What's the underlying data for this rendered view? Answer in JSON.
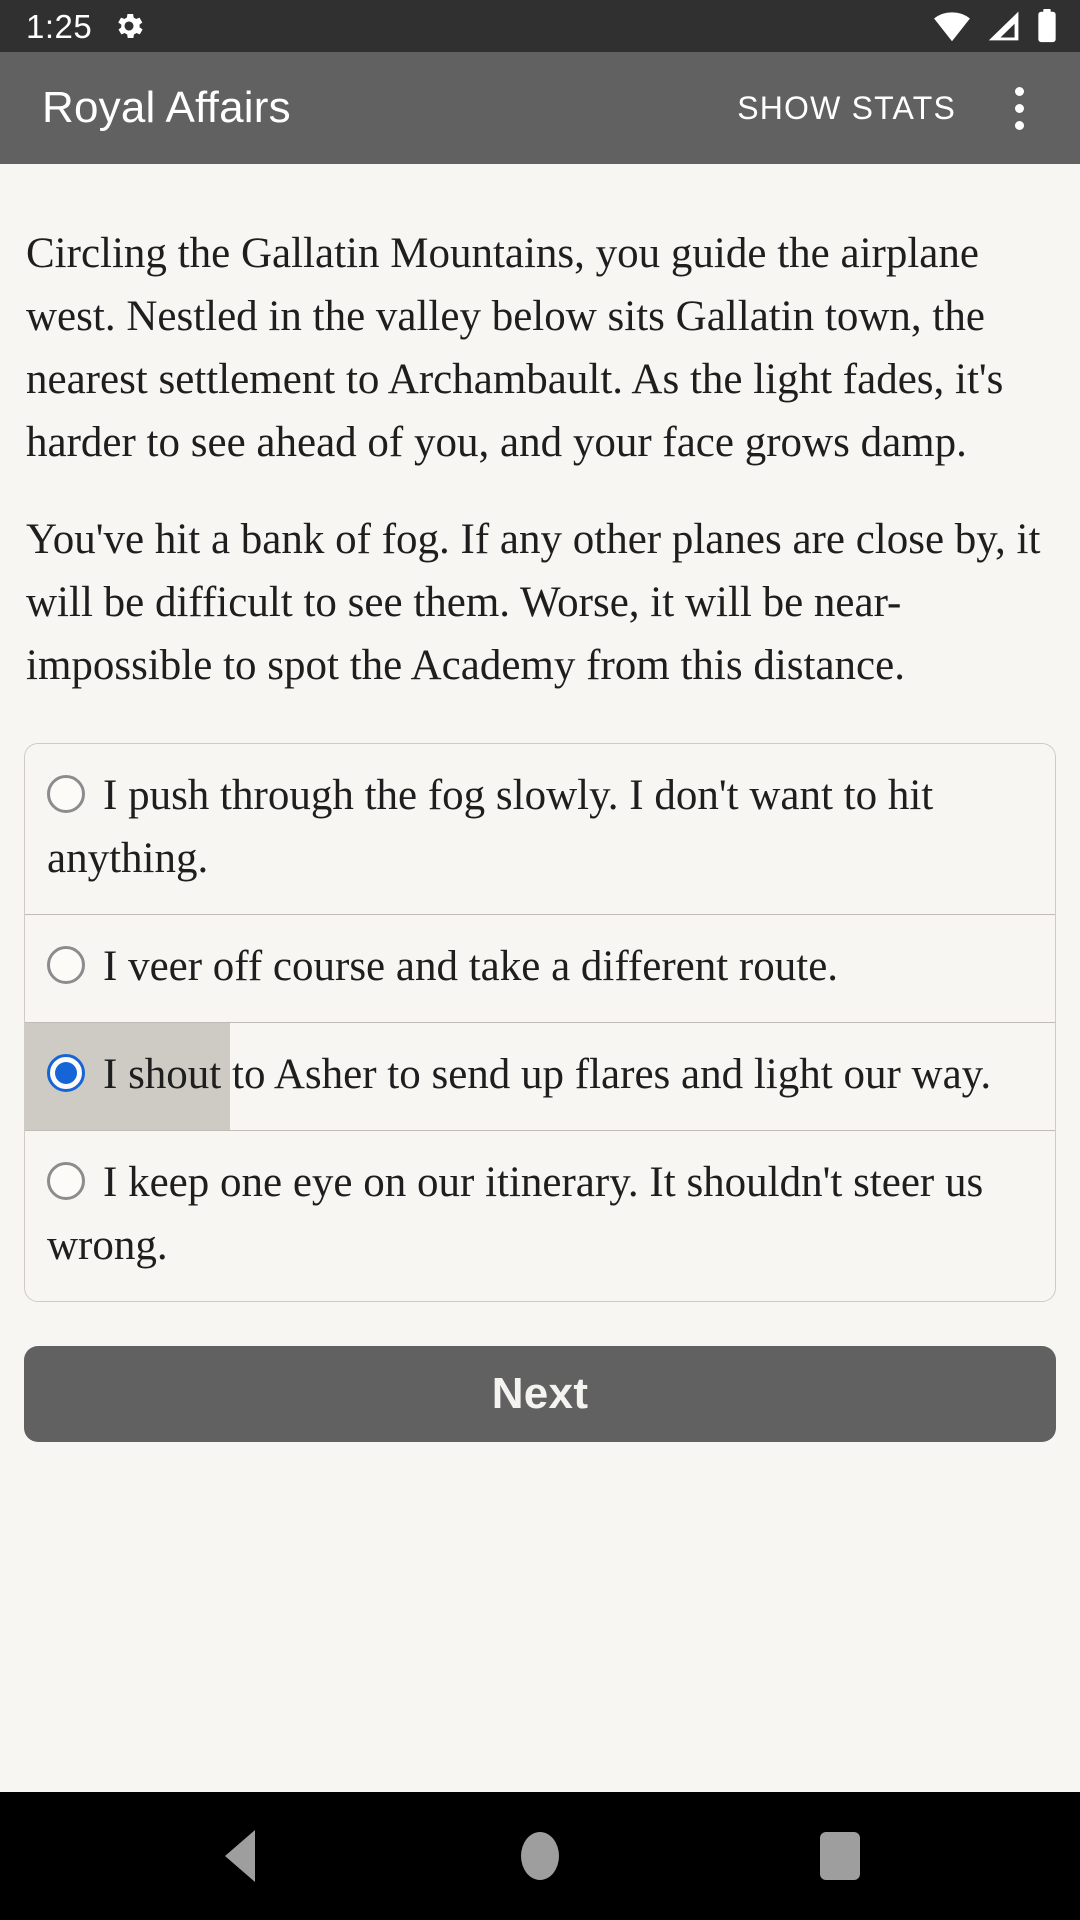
{
  "status_bar": {
    "time": "1:25",
    "icons": [
      "settings-gear-icon",
      "wifi-icon",
      "cell-signal-icon",
      "battery-icon"
    ],
    "background_color": "#303030"
  },
  "app_bar": {
    "title": "Royal Affairs",
    "action_label": "SHOW STATS",
    "overflow_icon": "more-vert-icon",
    "background_color": "#616161",
    "text_color": "#FFFFFF"
  },
  "story": {
    "paragraphs": [
      "Circling the Gallatin Mountains, you guide the airplane west. Nestled in the valley below sits Gallatin town, the nearest settlement to Archambault. As the light fades, it's harder to see ahead of you, and your face grows damp.",
      "You've hit a bank of fog. If any other planes are close by, it will be difficult to see them. Worse, it will be near-impossible to spot the Academy from this distance."
    ]
  },
  "choices": {
    "selected_index": 2,
    "accent_color": "#1565D8",
    "options": [
      {
        "label": "I push through the fog slowly. I don't want to hit anything.",
        "selected": false
      },
      {
        "label": "I veer off course and take a different route.",
        "selected": false
      },
      {
        "label": "I shout to Asher to send up flares and light our way.",
        "selected": true
      },
      {
        "label": "I keep one eye on our itinerary. It shouldn't steer us wrong.",
        "selected": false
      }
    ]
  },
  "next_button": {
    "label": "Next",
    "background_color": "#616161",
    "text_color": "#F5F3EF"
  },
  "nav_bar": {
    "background_color": "#000000",
    "buttons": [
      "back-icon",
      "home-icon",
      "recents-icon"
    ]
  },
  "page": {
    "background_color": "#F8F6F2",
    "text_color": "#1E1E1E"
  }
}
